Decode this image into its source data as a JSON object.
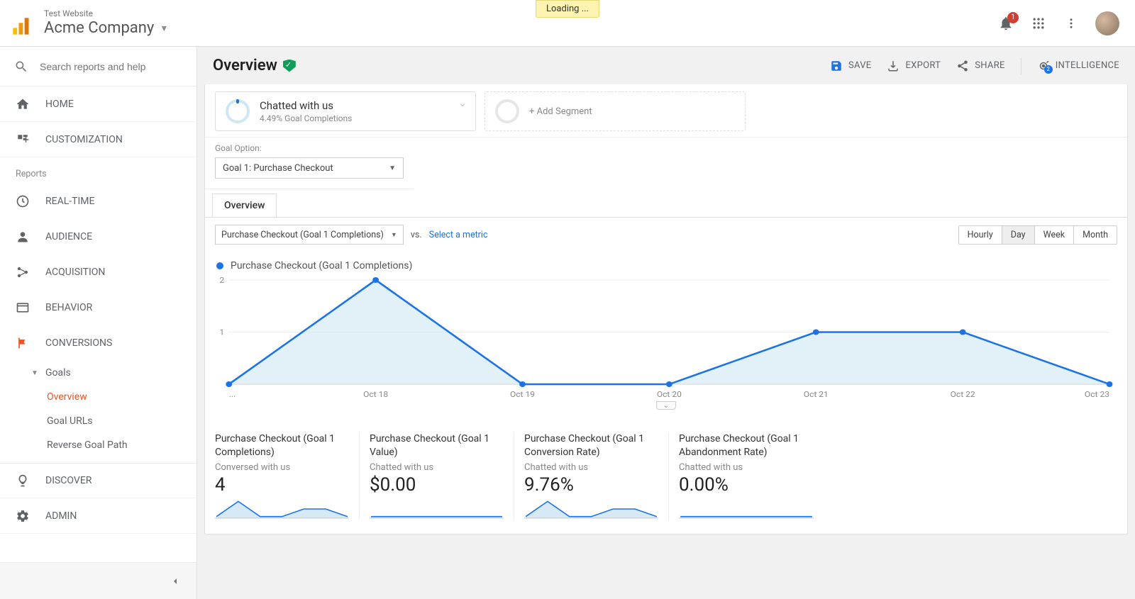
{
  "header": {
    "property_name": "Test Website",
    "account_name": "Acme Company",
    "loading": "Loading ...",
    "notifications_count": "1"
  },
  "search": {
    "placeholder": "Search reports and help"
  },
  "sidebar": {
    "home": "HOME",
    "customization": "CUSTOMIZATION",
    "reports_label": "Reports",
    "realtime": "REAL-TIME",
    "audience": "AUDIENCE",
    "acquisition": "ACQUISITION",
    "behavior": "BEHAVIOR",
    "conversions": "CONVERSIONS",
    "goals": "Goals",
    "overview": "Overview",
    "goal_urls": "Goal URLs",
    "reverse_goal_path": "Reverse Goal Path",
    "discover": "DISCOVER",
    "admin": "ADMIN"
  },
  "page": {
    "title": "Overview",
    "save": "SAVE",
    "export": "EXPORT",
    "share": "SHARE",
    "intelligence": "INTELLIGENCE",
    "intel_count": "2"
  },
  "segment": {
    "title": "Chatted with us",
    "sub": "4.49% Goal Completions",
    "add": "+ Add Segment"
  },
  "goal_option": {
    "label": "Goal Option:",
    "value": "Goal 1: Purchase Checkout"
  },
  "tab_overview": "Overview",
  "chart_control": {
    "metric_dd": "Purchase Checkout (Goal 1 Completions)",
    "vs": "vs.",
    "select_metric": "Select a metric",
    "hourly": "Hourly",
    "day": "Day",
    "week": "Week",
    "month": "Month"
  },
  "chart_legend": "Purchase Checkout (Goal 1 Completions)",
  "chart_data": {
    "type": "line",
    "title": "Purchase Checkout (Goal 1 Completions)",
    "xlabel": "",
    "ylabel": "",
    "ylim": [
      0,
      2
    ],
    "y_ticks": [
      1,
      2
    ],
    "categories": [
      "...",
      "Oct 18",
      "Oct 19",
      "Oct 20",
      "Oct 21",
      "Oct 22",
      "Oct 23"
    ],
    "series": [
      {
        "name": "Purchase Checkout (Goal 1 Completions)",
        "values": [
          0,
          2,
          0,
          0,
          1,
          1,
          0
        ]
      }
    ]
  },
  "cards": [
    {
      "title": "Purchase Checkout (Goal 1 Completions)",
      "sub": "Conversed with us",
      "value": "4",
      "spark": [
        0,
        2,
        0,
        0,
        1,
        1,
        0
      ]
    },
    {
      "title": "Purchase Checkout (Goal 1 Value)",
      "sub": "Chatted with us",
      "value": "$0.00",
      "spark": [
        0,
        0,
        0,
        0,
        0,
        0,
        0
      ]
    },
    {
      "title": "Purchase Checkout (Goal 1 Conversion Rate)",
      "sub": "Chatted with us",
      "value": "9.76%",
      "spark": [
        0,
        2,
        0,
        0,
        1,
        1,
        0
      ]
    },
    {
      "title": "Purchase Checkout (Goal 1 Abandonment Rate)",
      "sub": "Chatted with us",
      "value": "0.00%",
      "spark": [
        0,
        0,
        0,
        0,
        0,
        0,
        0
      ]
    }
  ]
}
